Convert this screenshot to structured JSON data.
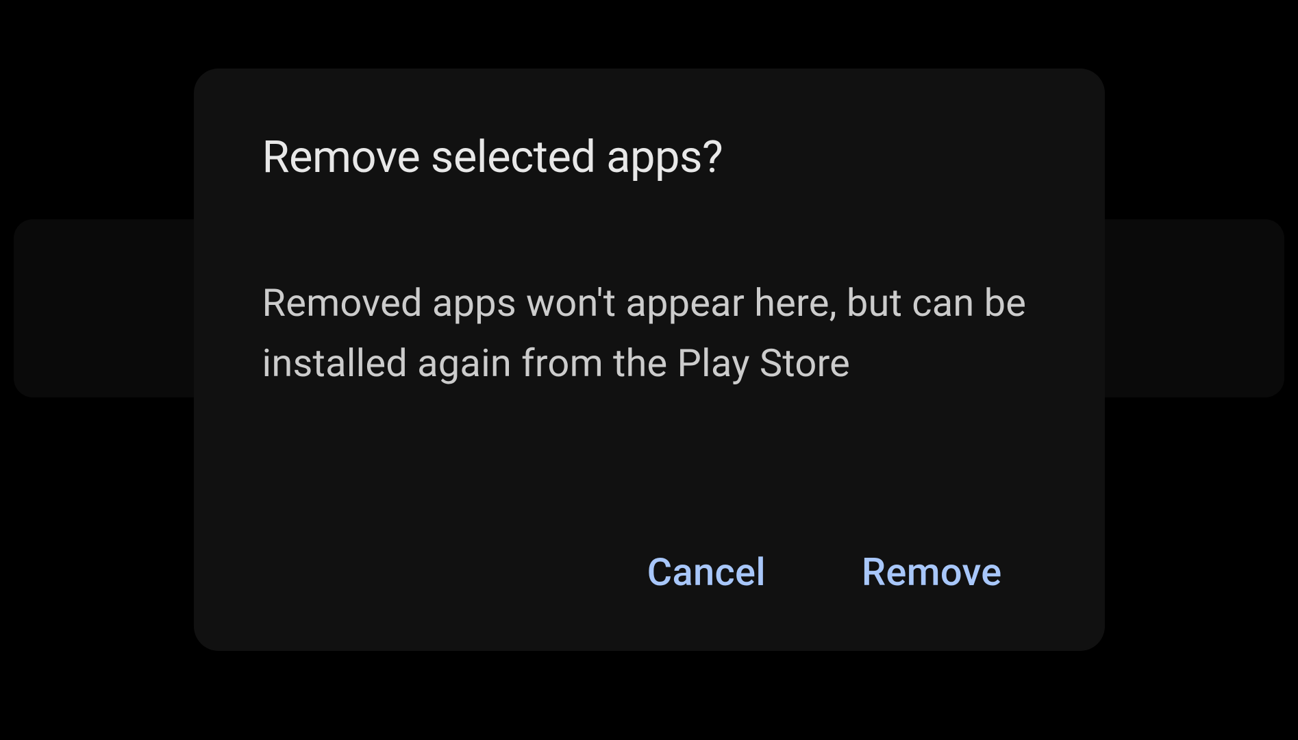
{
  "dialog": {
    "title": "Remove selected apps?",
    "message": "Removed apps won't appear here, but can be installed again from the Play Store",
    "actions": {
      "cancel": "Cancel",
      "confirm": "Remove"
    }
  },
  "colors": {
    "background": "#000000",
    "dialogSurface": "#111111",
    "titleText": "#e8e8e8",
    "bodyText": "#cccccc",
    "accent": "#a8c7fa"
  }
}
